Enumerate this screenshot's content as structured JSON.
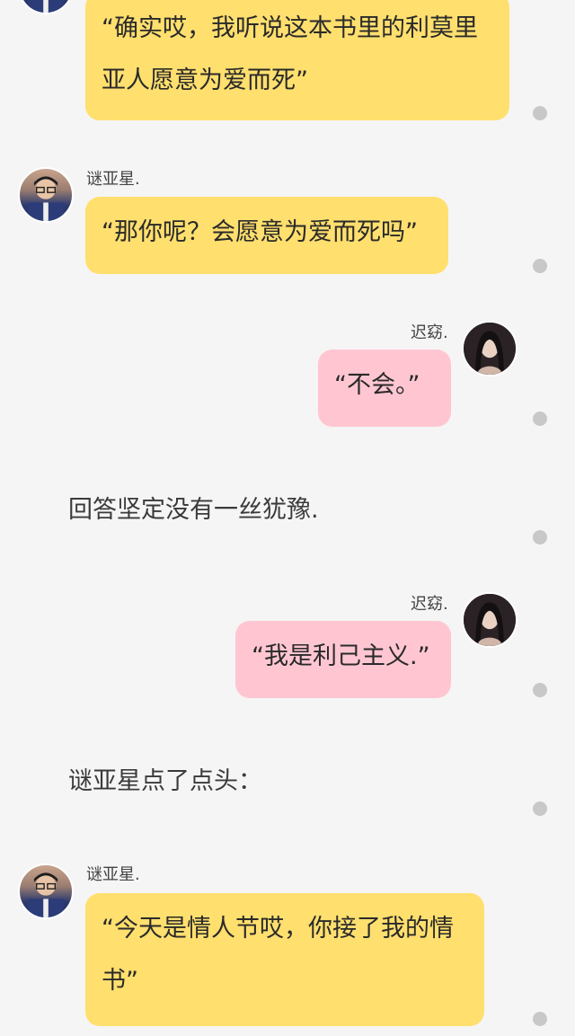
{
  "messages": [
    {
      "speaker": "",
      "text": "“确实哎，我听说这本书里的利莫里亚人愿意为爱而死”"
    },
    {
      "speaker": "谜亚星.",
      "text": "“那你呢？会愿意为爱而死吗”"
    },
    {
      "speaker": "迟窈.",
      "text": "“不会。”"
    },
    {
      "narration": "回答坚定没有一丝犹豫."
    },
    {
      "speaker": "迟窈.",
      "text": "“我是利己主义.”"
    },
    {
      "narration": "谜亚星点了点头："
    },
    {
      "speaker": "谜亚星.",
      "text": "“今天是情人节哎，你接了我的情书”"
    }
  ],
  "colors": {
    "left_bubble": "#ffdf6e",
    "right_bubble": "#ffc6d2",
    "background": "#f5f5f5",
    "dot": "#c8c8c8"
  },
  "icons": {
    "male_avatar": "avatar-male-icon",
    "female_avatar": "avatar-female-icon",
    "status_dot": "dot-icon"
  }
}
